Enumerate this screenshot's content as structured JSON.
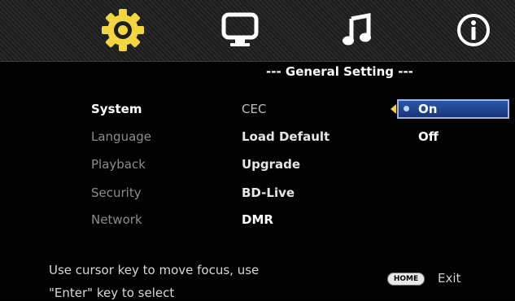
{
  "colors": {
    "accent_gear": "#f2d640",
    "selection_blue": "#2c58a6",
    "text_active": "#ffffff",
    "text_inactive": "#8d8d8d"
  },
  "tabs": [
    {
      "icon": "gear-icon"
    },
    {
      "icon": "monitor-icon"
    },
    {
      "icon": "music-note-icon"
    },
    {
      "icon": "info-icon"
    }
  ],
  "page": {
    "title": "--- General Setting ---"
  },
  "menu": {
    "items": [
      {
        "label": "System"
      },
      {
        "label": "Language"
      },
      {
        "label": "Playback"
      },
      {
        "label": "Security"
      },
      {
        "label": "Network"
      }
    ],
    "selected": "System"
  },
  "options": {
    "items": [
      {
        "label": "CEC"
      },
      {
        "label": "Load Default"
      },
      {
        "label": "Upgrade"
      },
      {
        "label": "BD-Live"
      },
      {
        "label": "DMR"
      }
    ]
  },
  "values": {
    "on": "On",
    "off": "Off",
    "selected": "On"
  },
  "footer": {
    "hint_line1": "Use cursor key to move focus, use",
    "hint_line2": "\"Enter\" key to select",
    "home_label": "HOME",
    "exit_label": "Exit"
  }
}
